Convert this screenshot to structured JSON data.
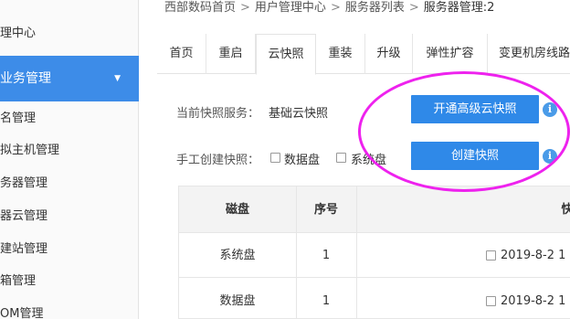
{
  "sidebar": {
    "items": [
      {
        "label": "理中心"
      },
      {
        "label": "业务管理"
      },
      {
        "label": "名管理"
      },
      {
        "label": "拟主机管理"
      },
      {
        "label": "务器管理"
      },
      {
        "label": "器云管理"
      },
      {
        "label": "建站管理"
      },
      {
        "label": "箱管理"
      },
      {
        "label": "OM管理"
      }
    ],
    "active_color": "#3d8ce8"
  },
  "breadcrumb": {
    "items": [
      "西部数码首页",
      "用户管理中心",
      "服务器列表",
      "服务器管理:2"
    ],
    "separator": ">"
  },
  "tabs": [
    "首页",
    "重启",
    "云快照",
    "重装",
    "升级",
    "弹性扩容",
    "变更机房线路"
  ],
  "snapshot": {
    "current_label": "当前快照服务：",
    "current_value": "基础云快照",
    "upgrade_button": "开通高级云快照",
    "manual_label": "手工创建快照：",
    "options": [
      "数据盘",
      "系统盘"
    ],
    "create_button": "创建快照",
    "info_glyph": "i"
  },
  "table": {
    "headers": [
      "磁盘",
      "序号",
      "快"
    ],
    "rows": [
      {
        "disk": "系统盘",
        "index": "1",
        "date": "2019-8-2 1"
      },
      {
        "disk": "数据盘",
        "index": "1",
        "date": "2019-8-2 1"
      }
    ]
  },
  "colors": {
    "primary": "#2f89e8",
    "annotation": "#ee22ee"
  }
}
